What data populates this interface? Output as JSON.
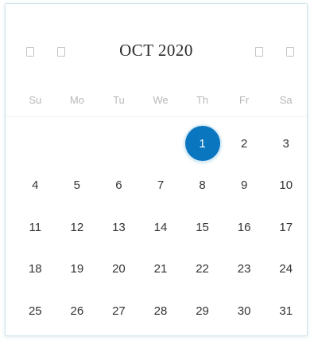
{
  "calendar": {
    "title": "OCT 2020",
    "weekdays": [
      "Su",
      "Mo",
      "Tu",
      "We",
      "Th",
      "Fr",
      "Sa"
    ],
    "leading_blanks": 4,
    "days": [
      1,
      2,
      3,
      4,
      5,
      6,
      7,
      8,
      9,
      10,
      11,
      12,
      13,
      14,
      15,
      16,
      17,
      18,
      19,
      20,
      21,
      22,
      23,
      24,
      25,
      26,
      27,
      28,
      29,
      30,
      31
    ],
    "selected_day": 1,
    "colors": {
      "selected_bg": "#0a76bf",
      "weekday_text": "#b8b8b8",
      "day_text": "#333333"
    },
    "nav_icons": [
      "prev-year-icon",
      "prev-month-icon",
      "next-month-icon",
      "next-year-icon"
    ]
  }
}
